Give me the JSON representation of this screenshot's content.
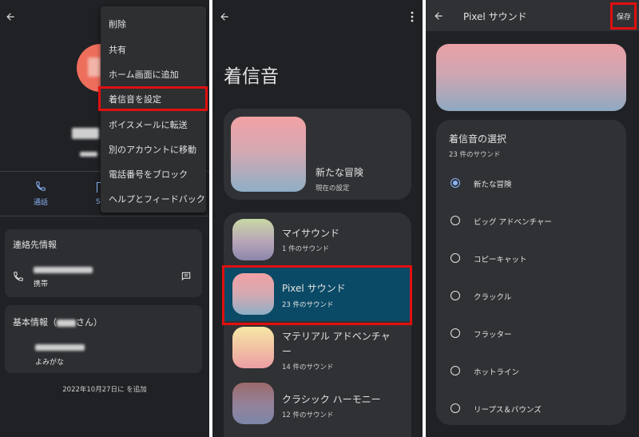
{
  "panel1": {
    "back_icon": "arrow-left-icon",
    "menu": {
      "items": [
        "削除",
        "共有",
        "ホーム画面に追加",
        "着信音を設定",
        "ボイスメールに転送",
        "別のアカウントに移動",
        "電話番号をブロック",
        "ヘルプとフィードバック"
      ],
      "highlighted_index": 3
    },
    "actions": [
      {
        "label": "通話",
        "icon": "phone-icon"
      }
    ],
    "contact_section": {
      "title": "連絡先情報",
      "phone_type": "携帯"
    },
    "basic_section": {
      "title_prefix": "基本情報（",
      "title_suffix": "さん）",
      "reading_label": "よみがな"
    },
    "added_date": "2022年10月27日に を追加"
  },
  "panel2": {
    "title": "着信音",
    "current": {
      "name": "新たな冒険",
      "subtitle": "現在の設定"
    },
    "categories": [
      {
        "name": "マイサウンド",
        "count": "1 件のサウンド"
      },
      {
        "name": "Pixel サウンド",
        "count": "23 件のサウンド"
      },
      {
        "name_line1": "マテリアル アドベンチャ",
        "name_line2": "ー",
        "count": "14 件のサウンド"
      },
      {
        "name": "クラシック ハーモニー",
        "count": "12 件のサウンド"
      }
    ]
  },
  "panel3": {
    "title": "Pixel サウンド",
    "save": "保存",
    "section_title": "着信音の選択",
    "section_count": "23 件のサウンド",
    "options": [
      "新たな冒険",
      "ビッグ アドベンチャー",
      "コピーキャット",
      "クラックル",
      "フラッター",
      "ホットライン",
      "リープス＆バウンズ"
    ],
    "selected_index": 0
  },
  "colors": {
    "accent": "#8ab4f8",
    "highlight": "#e01010",
    "selected_row": "#0a4a66"
  }
}
